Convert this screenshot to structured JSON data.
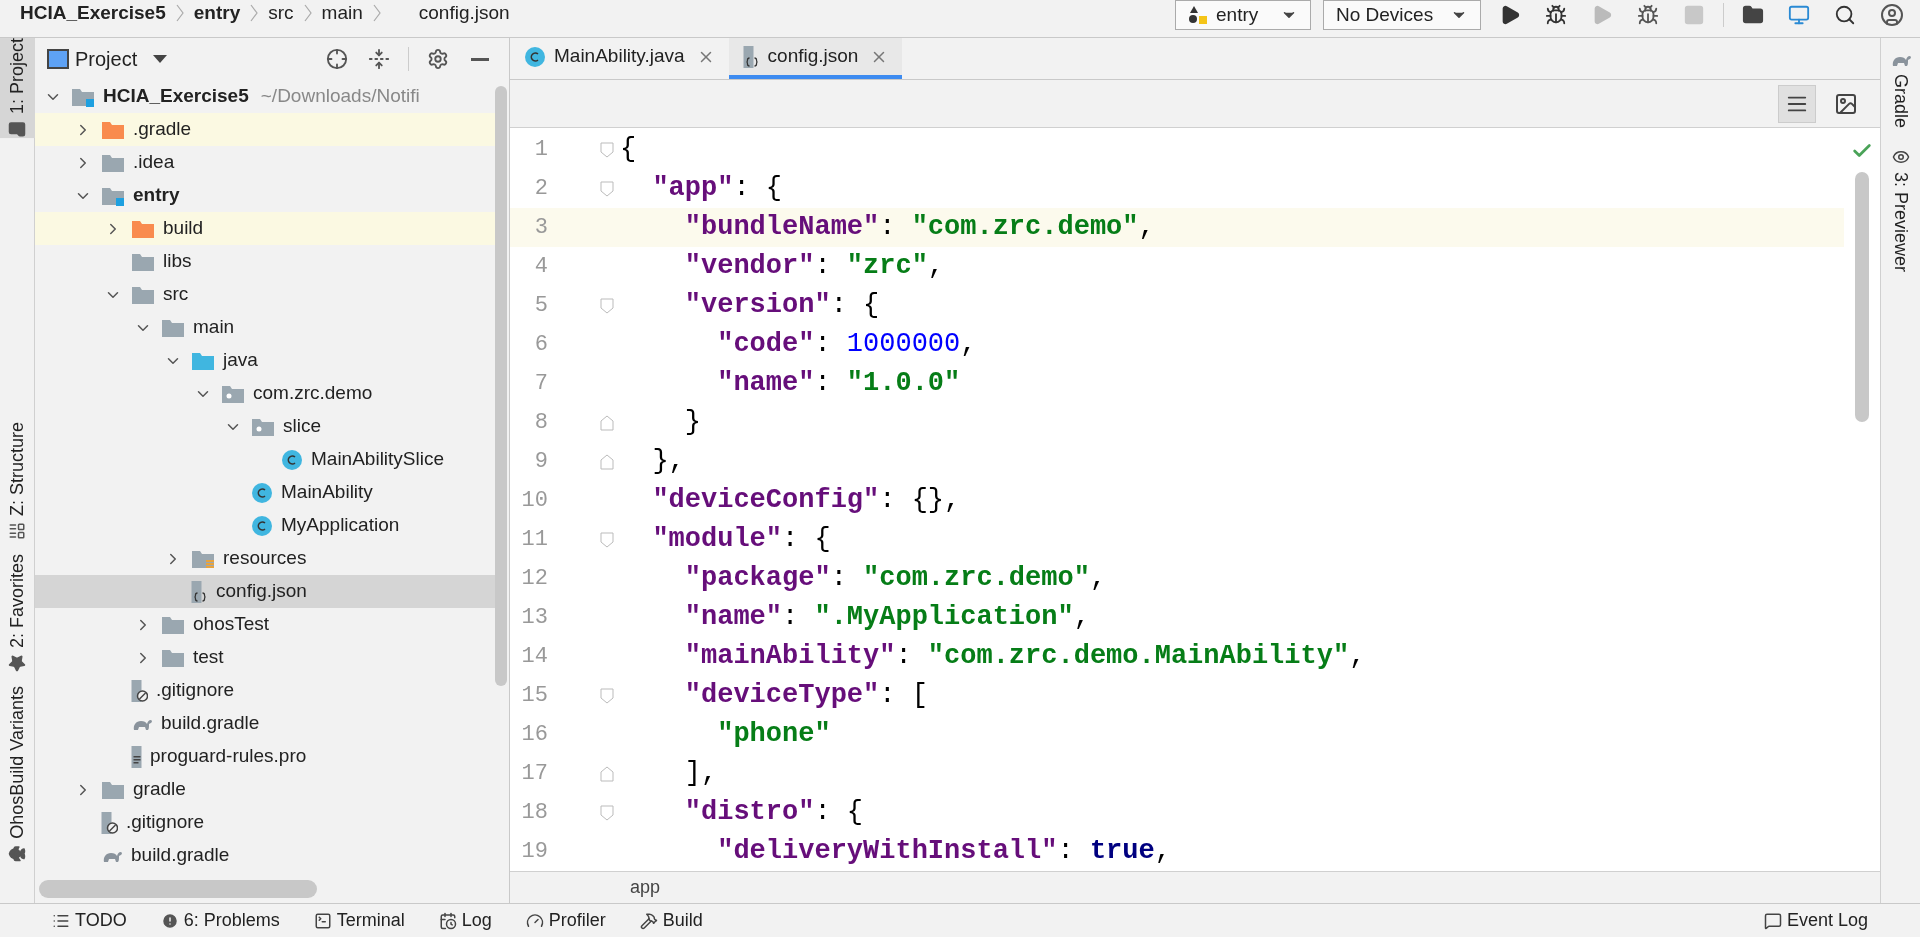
{
  "breadcrumbs": [
    {
      "label": "HCIA_Exercise5",
      "bold": true
    },
    {
      "label": "entry",
      "bold": true
    },
    {
      "label": "src",
      "bold": false
    },
    {
      "label": "main",
      "bold": false
    },
    {
      "label": "config.json",
      "bold": false
    }
  ],
  "run_config": {
    "label": "entry"
  },
  "device": {
    "label": "No Devices"
  },
  "left_stripe": [
    {
      "label": "1: Project",
      "selected": true,
      "kind": "project"
    },
    {
      "label": "Z: Structure",
      "selected": false,
      "kind": "structure"
    },
    {
      "label": "2: Favorites",
      "selected": false,
      "kind": "favorites"
    },
    {
      "label": "OhosBuild Variants",
      "selected": false,
      "kind": "variants"
    }
  ],
  "right_stripe": [
    {
      "label": "Gradle",
      "kind": "gradle"
    },
    {
      "label": "3: Previewer",
      "kind": "previewer"
    }
  ],
  "project_panel": {
    "title": "Project",
    "tree": [
      {
        "label": "HCIA_Exercise5",
        "note": "~/Downloads/Notifi",
        "kind": "module",
        "expanded": true,
        "selected": false,
        "children": [
          {
            "label": ".gradle",
            "kind": "excluded",
            "expanded": false,
            "selected": false
          },
          {
            "label": ".idea",
            "kind": "folder",
            "expanded": false,
            "selected": false
          },
          {
            "label": "entry",
            "kind": "module",
            "expanded": true,
            "selected": false,
            "children": [
              {
                "label": "build",
                "kind": "excluded",
                "expanded": false,
                "selected": false
              },
              {
                "label": "libs",
                "kind": "folder",
                "selected": false
              },
              {
                "label": "src",
                "kind": "folder",
                "expanded": true,
                "selected": false,
                "children": [
                  {
                    "label": "main",
                    "kind": "folder",
                    "expanded": true,
                    "selected": false,
                    "children": [
                      {
                        "label": "java",
                        "kind": "source",
                        "expanded": true,
                        "selected": false,
                        "children": [
                          {
                            "label": "com.zrc.demo",
                            "kind": "package",
                            "expanded": true,
                            "selected": false,
                            "children": [
                              {
                                "label": "slice",
                                "kind": "package",
                                "expanded": true,
                                "selected": false,
                                "children": [
                                  {
                                    "label": "MainAbilitySlice",
                                    "kind": "class",
                                    "selected": false
                                  }
                                ]
                              },
                              {
                                "label": "MainAbility",
                                "kind": "class",
                                "selected": false
                              },
                              {
                                "label": "MyApplication",
                                "kind": "class",
                                "selected": false
                              }
                            ]
                          }
                        ]
                      },
                      {
                        "label": "resources",
                        "kind": "resources",
                        "expanded": false,
                        "selected": false
                      },
                      {
                        "label": "config.json",
                        "kind": "json",
                        "selected": true
                      }
                    ]
                  },
                  {
                    "label": "ohosTest",
                    "kind": "folder",
                    "expanded": false,
                    "selected": false
                  },
                  {
                    "label": "test",
                    "kind": "folder",
                    "expanded": false,
                    "selected": false
                  }
                ]
              },
              {
                "label": ".gitignore",
                "kind": "ignore",
                "selected": false
              },
              {
                "label": "build.gradle",
                "kind": "gradle",
                "selected": false
              },
              {
                "label": "proguard-rules.pro",
                "kind": "text",
                "selected": false
              }
            ]
          },
          {
            "label": "gradle",
            "kind": "folder",
            "expanded": false,
            "selected": false
          },
          {
            "label": ".gitignore",
            "kind": "ignore",
            "selected": false
          },
          {
            "label": "build.gradle",
            "kind": "gradle",
            "selected": false
          }
        ]
      }
    ]
  },
  "editor": {
    "tabs": [
      {
        "label": "MainAbility.java",
        "kind": "class",
        "selected": false
      },
      {
        "label": "config.json",
        "kind": "json",
        "selected": true
      }
    ],
    "lines": [
      {
        "number": "1",
        "fold": {
          "kind": "start"
        },
        "current": false,
        "tokens": [
          {
            "kind": "punct",
            "text": "{"
          }
        ]
      },
      {
        "number": "2",
        "fold": {
          "kind": "start"
        },
        "current": false,
        "tokens": [
          {
            "kind": "key",
            "text": "  \"app\""
          },
          {
            "kind": "punct",
            "text": ": {"
          }
        ]
      },
      {
        "number": "3",
        "current": true,
        "tokens": [
          {
            "kind": "key",
            "text": "    \"bundleName\""
          },
          {
            "kind": "punct",
            "text": ": "
          },
          {
            "kind": "string",
            "text": "\"com.zrc.demo\""
          },
          {
            "kind": "punct",
            "text": ","
          }
        ]
      },
      {
        "number": "4",
        "current": false,
        "tokens": [
          {
            "kind": "key",
            "text": "    \"vendor\""
          },
          {
            "kind": "punct",
            "text": ": "
          },
          {
            "kind": "string",
            "text": "\"zrc\""
          },
          {
            "kind": "punct",
            "text": ","
          }
        ]
      },
      {
        "number": "5",
        "fold": {
          "kind": "start"
        },
        "current": false,
        "tokens": [
          {
            "kind": "key",
            "text": "    \"version\""
          },
          {
            "kind": "punct",
            "text": ": {"
          }
        ]
      },
      {
        "number": "6",
        "current": false,
        "tokens": [
          {
            "kind": "key",
            "text": "      \"code\""
          },
          {
            "kind": "punct",
            "text": ": "
          },
          {
            "kind": "number",
            "text": "1000000"
          },
          {
            "kind": "punct",
            "text": ","
          }
        ]
      },
      {
        "number": "7",
        "current": false,
        "tokens": [
          {
            "kind": "key",
            "text": "      \"name\""
          },
          {
            "kind": "punct",
            "text": ": "
          },
          {
            "kind": "string",
            "text": "\"1.0.0\""
          }
        ]
      },
      {
        "number": "8",
        "fold": {
          "kind": "end"
        },
        "current": false,
        "tokens": [
          {
            "kind": "punct",
            "text": "    }"
          }
        ]
      },
      {
        "number": "9",
        "fold": {
          "kind": "end"
        },
        "current": false,
        "tokens": [
          {
            "kind": "punct",
            "text": "  },"
          }
        ]
      },
      {
        "number": "10",
        "current": false,
        "tokens": [
          {
            "kind": "key",
            "text": "  \"deviceConfig\""
          },
          {
            "kind": "punct",
            "text": ": {},"
          }
        ]
      },
      {
        "number": "11",
        "fold": {
          "kind": "start"
        },
        "current": false,
        "tokens": [
          {
            "kind": "key",
            "text": "  \"module\""
          },
          {
            "kind": "punct",
            "text": ": {"
          }
        ]
      },
      {
        "number": "12",
        "current": false,
        "tokens": [
          {
            "kind": "key",
            "text": "    \"package\""
          },
          {
            "kind": "punct",
            "text": ": "
          },
          {
            "kind": "string",
            "text": "\"com.zrc.demo\""
          },
          {
            "kind": "punct",
            "text": ","
          }
        ]
      },
      {
        "number": "13",
        "current": false,
        "tokens": [
          {
            "kind": "key",
            "text": "    \"name\""
          },
          {
            "kind": "punct",
            "text": ": "
          },
          {
            "kind": "string",
            "text": "\".MyApplication\""
          },
          {
            "kind": "punct",
            "text": ","
          }
        ]
      },
      {
        "number": "14",
        "current": false,
        "tokens": [
          {
            "kind": "key",
            "text": "    \"mainAbility\""
          },
          {
            "kind": "punct",
            "text": ": "
          },
          {
            "kind": "string",
            "text": "\"com.zrc.demo.MainAbility\""
          },
          {
            "kind": "punct",
            "text": ","
          }
        ]
      },
      {
        "number": "15",
        "fold": {
          "kind": "start"
        },
        "current": false,
        "tokens": [
          {
            "kind": "key",
            "text": "    \"deviceType\""
          },
          {
            "kind": "punct",
            "text": ": ["
          }
        ]
      },
      {
        "number": "16",
        "current": false,
        "tokens": [
          {
            "kind": "string",
            "text": "      \"phone\""
          }
        ]
      },
      {
        "number": "17",
        "fold": {
          "kind": "end"
        },
        "current": false,
        "tokens": [
          {
            "kind": "punct",
            "text": "    ],"
          }
        ]
      },
      {
        "number": "18",
        "fold": {
          "kind": "start"
        },
        "current": false,
        "tokens": [
          {
            "kind": "key",
            "text": "    \"distro\""
          },
          {
            "kind": "punct",
            "text": ": {"
          }
        ]
      },
      {
        "number": "19",
        "current": false,
        "tokens": [
          {
            "kind": "key",
            "text": "      \"deliveryWithInstall\""
          },
          {
            "kind": "punct",
            "text": ": "
          },
          {
            "kind": "keyword",
            "text": "true"
          },
          {
            "kind": "punct",
            "text": ","
          }
        ]
      }
    ],
    "path": "app"
  },
  "status_bar": {
    "left": [
      {
        "label": "TODO",
        "kind": "todo"
      },
      {
        "label": "6: Problems",
        "kind": "problems"
      },
      {
        "label": "Terminal",
        "kind": "terminal"
      },
      {
        "label": "Log",
        "kind": "log"
      },
      {
        "label": "Profiler",
        "kind": "profiler"
      },
      {
        "label": "Build",
        "kind": "build"
      }
    ],
    "right": [
      {
        "label": "Event Log",
        "kind": "events"
      }
    ]
  }
}
